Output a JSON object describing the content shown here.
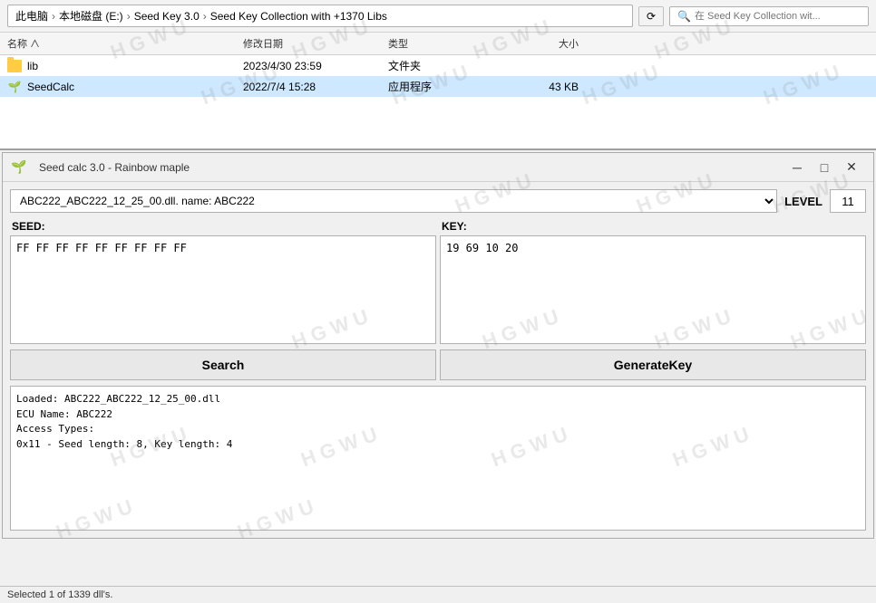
{
  "explorer": {
    "breadcrumb": {
      "parts": [
        "此电脑",
        "本地磁盘 (E:)",
        "Seed Key 3.0",
        "Seed Key Collection with +1370 Libs"
      ]
    },
    "search_placeholder": "在 Seed Key Collection wit...",
    "columns": [
      "名称",
      "修改日期",
      "类型",
      "大小"
    ],
    "files": [
      {
        "name": "lib",
        "date": "2023/4/30 23:59",
        "type": "文件夹",
        "size": "",
        "icon": "folder"
      },
      {
        "name": "SeedCalc",
        "date": "2022/7/4 15:28",
        "type": "应用程序",
        "size": "43 KB",
        "icon": "exe"
      }
    ]
  },
  "app_window": {
    "title": "Seed calc 3.0 - Rainbow maple",
    "controls": {
      "minimize": "─",
      "maximize": "□",
      "close": "✕"
    }
  },
  "dll_select": {
    "value": "ABC222_ABC222_12_25_00.dll. name: ABC222",
    "placeholder": "ABC222_ABC222_12_25_00.dll. name: ABC222"
  },
  "level": {
    "label": "LEVEL",
    "value": "11"
  },
  "seed": {
    "label": "SEED:",
    "value": "FF FF FF FF FF FF FF FF FF"
  },
  "key": {
    "label": "KEY:",
    "value": "19 69 10 20"
  },
  "buttons": {
    "search": "Search",
    "generate": "GenerateKey"
  },
  "log": {
    "lines": [
      "Loaded: ABC222_ABC222_12_25_00.dll",
      "ECU Name: ABC222",
      "Access Types:",
      "0x11 - Seed length: 8, Key length: 4"
    ]
  },
  "status_bar": {
    "text": "Selected 1 of 1339 dll's."
  },
  "watermark_texts": [
    "HGWU",
    "HGWU",
    "HGWU",
    "HGWU",
    "HGWU"
  ]
}
